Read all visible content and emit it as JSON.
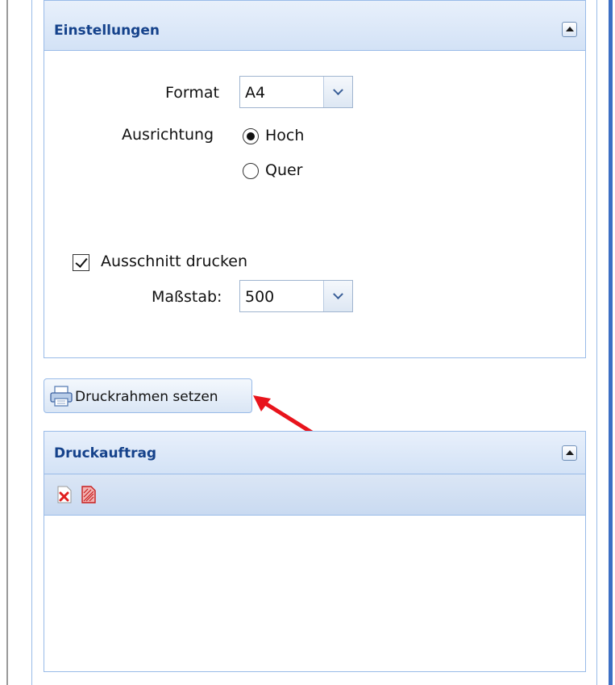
{
  "settings": {
    "title": "Einstellungen",
    "format_label": "Format",
    "format_value": "A4",
    "orientation_label": "Ausrichtung",
    "orientation_options": [
      {
        "label": "Hoch",
        "checked": true
      },
      {
        "label": "Quer",
        "checked": false
      }
    ],
    "clip_print_label": "Ausschnitt drucken",
    "clip_print_checked": true,
    "scale_label": "Maßstab:",
    "scale_value": "500"
  },
  "print_frame_button": {
    "label": "Druckrahmen setzen",
    "icon": "printer-icon"
  },
  "annotation": {
    "type": "red-arrow",
    "color": "#e8141c"
  },
  "print_job": {
    "title": "Druckauftrag",
    "toolbar": [
      {
        "icon": "delete-icon"
      },
      {
        "icon": "pdf-document-icon"
      }
    ]
  },
  "colors": {
    "header_text": "#15428b",
    "border": "#99bbe8",
    "accent_right": "#3c6fc4"
  }
}
